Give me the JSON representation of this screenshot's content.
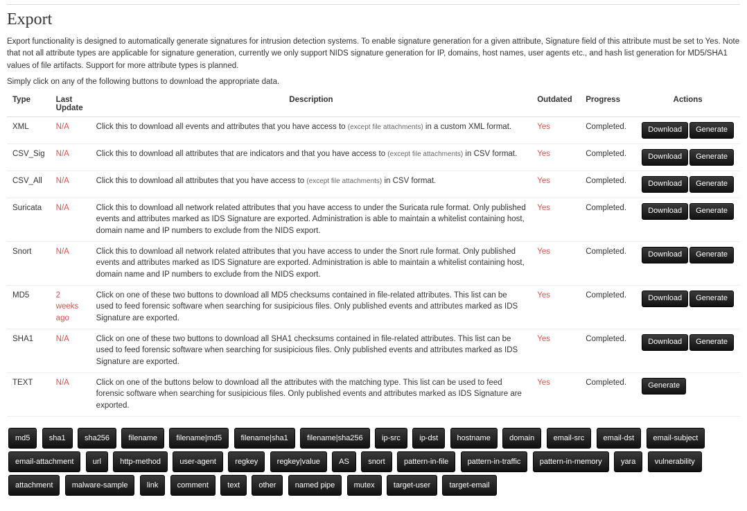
{
  "page": {
    "title": "Export",
    "intro": "Export functionality is designed to automatically generate signatures for intrusion detection systems. To enable signature generation for a given attribute, Signature field of this attribute must be set to Yes. Note that not all attribute types are applicable for signature generation, currently we only support NIDS signature generation for IP, domains, host names, user agents etc., and hash list generation for MD5/SHA1 values of file artifacts. Support for more attribute types is planned.",
    "sub": "Simply click on any of the following buttons to download the appropriate data."
  },
  "table": {
    "headers": {
      "type": "Type",
      "last": "Last Update",
      "desc": "Description",
      "outdated": "Outdated",
      "progress": "Progress",
      "actions": "Actions"
    },
    "note_except": "(except file attachments)",
    "buttons": {
      "download": "Download",
      "generate": "Generate"
    },
    "rows": [
      {
        "type": "XML",
        "last": "N/A",
        "desc_pre": "Click this to download all events and attributes that you have access to ",
        "desc_post": " in a custom XML format.",
        "outdated": "Yes",
        "progress": "Completed.",
        "download": true,
        "generate": true
      },
      {
        "type": "CSV_Sig",
        "last": "N/A",
        "desc_pre": "Click this to download all attributes that are indicators and that you have access to ",
        "desc_post": " in CSV format.",
        "outdated": "Yes",
        "progress": "Completed.",
        "download": true,
        "generate": true
      },
      {
        "type": "CSV_All",
        "last": "N/A",
        "desc_pre": "Click this to download all attributes that you have access to ",
        "desc_post": " in CSV format.",
        "outdated": "Yes",
        "progress": "Completed.",
        "download": true,
        "generate": true
      },
      {
        "type": "Suricata",
        "last": "N/A",
        "desc_full": "Click this to download all network related attributes that you have access to under the Suricata rule format. Only published events and attributes marked as IDS Signature are exported. Administration is able to maintain a whitelist containing host, domain name and IP numbers to exclude from the NIDS export.",
        "outdated": "Yes",
        "progress": "Completed.",
        "download": true,
        "generate": true
      },
      {
        "type": "Snort",
        "last": "N/A",
        "desc_full": "Click this to download all network related attributes that you have access to under the Snort rule format. Only published events and attributes marked as IDS Signature are exported. Administration is able to maintain a whitelist containing host, domain name and IP numbers to exclude from the NIDS export.",
        "outdated": "Yes",
        "progress": "Completed.",
        "download": true,
        "generate": true
      },
      {
        "type": "MD5",
        "last": "2 weeks ago",
        "desc_full": "Click on one of these two buttons to download all MD5 checksums contained in file-related attributes. This list can be used to feed forensic software when searching for susipicious files. Only published events and attributes marked as IDS Signature are exported.",
        "outdated": "Yes",
        "progress": "Completed.",
        "download": true,
        "generate": true
      },
      {
        "type": "SHA1",
        "last": "N/A",
        "desc_full": "Click on one of these two buttons to download all SHA1 checksums contained in file-related attributes. This list can be used to feed forensic software when searching for susipicious files. Only published events and attributes marked as IDS Signature are exported.",
        "outdated": "Yes",
        "progress": "Completed.",
        "download": true,
        "generate": true
      },
      {
        "type": "TEXT",
        "last": "N/A",
        "desc_full": "Click on one of the buttons below to download all the attributes with the matching type. This list can be used to feed forensic software when searching for susipicious files. Only published events and attributes marked as IDS Signature are exported.",
        "outdated": "Yes",
        "progress": "Completed.",
        "download": false,
        "generate": true
      }
    ]
  },
  "tags": [
    "md5",
    "sha1",
    "sha256",
    "filename",
    "filename|md5",
    "filename|sha1",
    "filename|sha256",
    "ip-src",
    "ip-dst",
    "hostname",
    "domain",
    "email-src",
    "email-dst",
    "email-subject",
    "email-attachment",
    "url",
    "http-method",
    "user-agent",
    "regkey",
    "regkey|value",
    "AS",
    "snort",
    "pattern-in-file",
    "pattern-in-traffic",
    "pattern-in-memory",
    "yara",
    "vulnerability",
    "attachment",
    "malware-sample",
    "link",
    "comment",
    "text",
    "other",
    "named pipe",
    "mutex",
    "target-user",
    "target-email"
  ]
}
